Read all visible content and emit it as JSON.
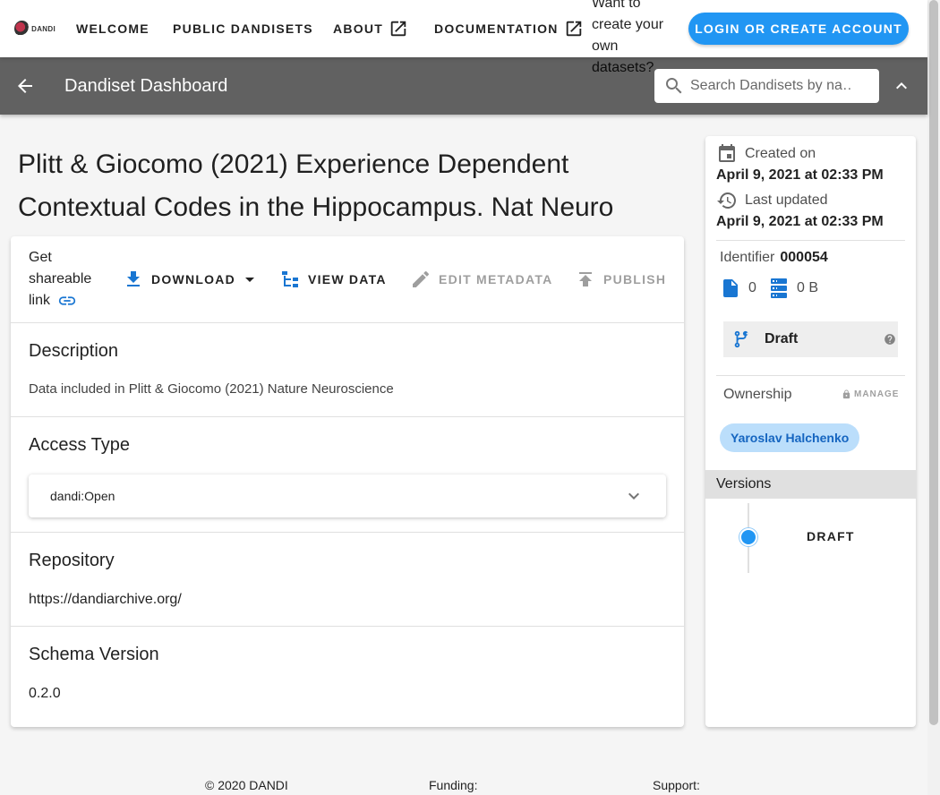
{
  "nav": {
    "logo_text": "DANDI",
    "items": [
      {
        "label": "WELCOME"
      },
      {
        "label": "PUBLIC DANDISETS"
      },
      {
        "label": "ABOUT"
      },
      {
        "label": "DOCUMENTATION"
      }
    ],
    "promo": "Want to create your own datasets?",
    "login_label": "LOGIN OR CREATE ACCOUNT"
  },
  "toolbar": {
    "title": "Dandiset Dashboard",
    "search_placeholder": "Search Dandisets by na…"
  },
  "dandiset": {
    "title": "Plitt & Giocomo (2021) Experience Dependent Contextual Codes in the Hippocampus. Nat Neuro"
  },
  "actions": {
    "share_label": "Get shareable link",
    "download_label": "DOWNLOAD",
    "view_data_label": "VIEW DATA",
    "edit_metadata_label": "EDIT METADATA",
    "publish_label": "PUBLISH"
  },
  "sections": {
    "description": {
      "heading": "Description",
      "value": "Data included in Plitt & Giocomo (2021) Nature Neuroscience"
    },
    "access_type": {
      "heading": "Access Type",
      "value": "dandi:Open"
    },
    "repository": {
      "heading": "Repository",
      "value": "https://dandiarchive.org/"
    },
    "schema_version": {
      "heading": "Schema Version",
      "value": "0.2.0"
    }
  },
  "side": {
    "created_label": "Created on",
    "created_date": "April 9, 2021 at 02:33 PM",
    "updated_label": "Last updated",
    "updated_date": "April 9, 2021 at 02:33 PM",
    "identifier_label": "Identifier",
    "identifier_value": "000054",
    "file_count": "0",
    "size": "0 B",
    "status": "Draft",
    "ownership_label": "Ownership",
    "manage_label": "MANAGE",
    "owner": "Yaroslav Halchenko",
    "versions_label": "Versions",
    "version": "DRAFT"
  },
  "footer": {
    "copyright": "© 2020 DANDI",
    "funding": "Funding:",
    "support": "Support:"
  },
  "colors": {
    "accent": "#2196f3",
    "toolbar": "#616161",
    "chip_bg": "#bbdefb"
  },
  "icons": [
    "arrow-left-icon",
    "search-icon",
    "chevron-up-icon",
    "open-in-new-icon",
    "link-icon",
    "download-icon",
    "caret-down-icon",
    "file-tree-icon",
    "pencil-icon",
    "upload-icon",
    "chevron-down-icon",
    "calendar-icon",
    "history-icon",
    "file-icon",
    "server-icon",
    "branch-icon",
    "help-icon",
    "lock-icon"
  ]
}
